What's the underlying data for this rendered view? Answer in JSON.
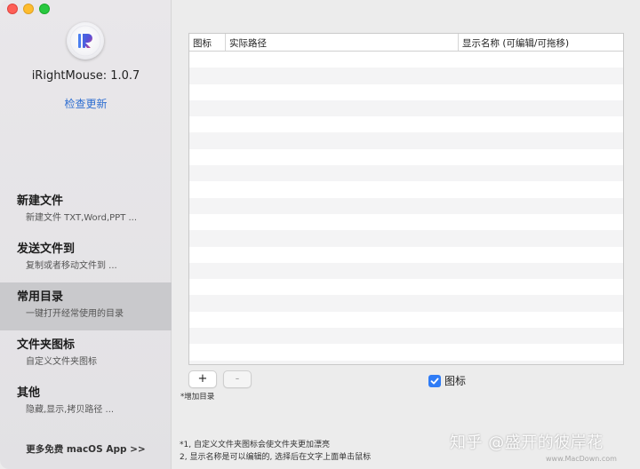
{
  "app": {
    "name_version": "iRightMouse: 1.0.7",
    "check_update": "检查更新",
    "more_apps": "更多免费 macOS App >>"
  },
  "sidebar": {
    "items": [
      {
        "title": "新建文件",
        "subtitle": "新建文件 TXT,Word,PPT ...",
        "active": false
      },
      {
        "title": "发送文件到",
        "subtitle": "复制或者移动文件到 ...",
        "active": false
      },
      {
        "title": "常用目录",
        "subtitle": "一键打开经常使用的目录",
        "active": true
      },
      {
        "title": "文件夹图标",
        "subtitle": "自定义文件夹图标",
        "active": false
      },
      {
        "title": "其他",
        "subtitle": "隐藏,显示,拷贝路径 ...",
        "active": false
      }
    ]
  },
  "table": {
    "columns": [
      "图标",
      "实际路径",
      "显示名称 (可编辑/可拖移)"
    ],
    "rows": []
  },
  "controls": {
    "add_label": "+",
    "remove_label": "-",
    "add_hint": "*增加目录",
    "icon_checkbox_label": "图标",
    "icon_checkbox_checked": true
  },
  "notes": {
    "line1": "*1, 自定义文件夹图标会使文件夹更加漂亮",
    "line2": "2, 显示名称是可以编辑的, 选择后在文字上面单击鼠标"
  },
  "watermark": {
    "text": "知乎 @盛开的彼岸花",
    "small": "www.MacDown.com"
  },
  "colors": {
    "accent": "#2f7cf6",
    "link": "#2f6fd1",
    "sidebar_active": "#c9c9cc",
    "close": "#fe5f57",
    "minimize": "#febc2e",
    "maximize": "#28c840"
  }
}
